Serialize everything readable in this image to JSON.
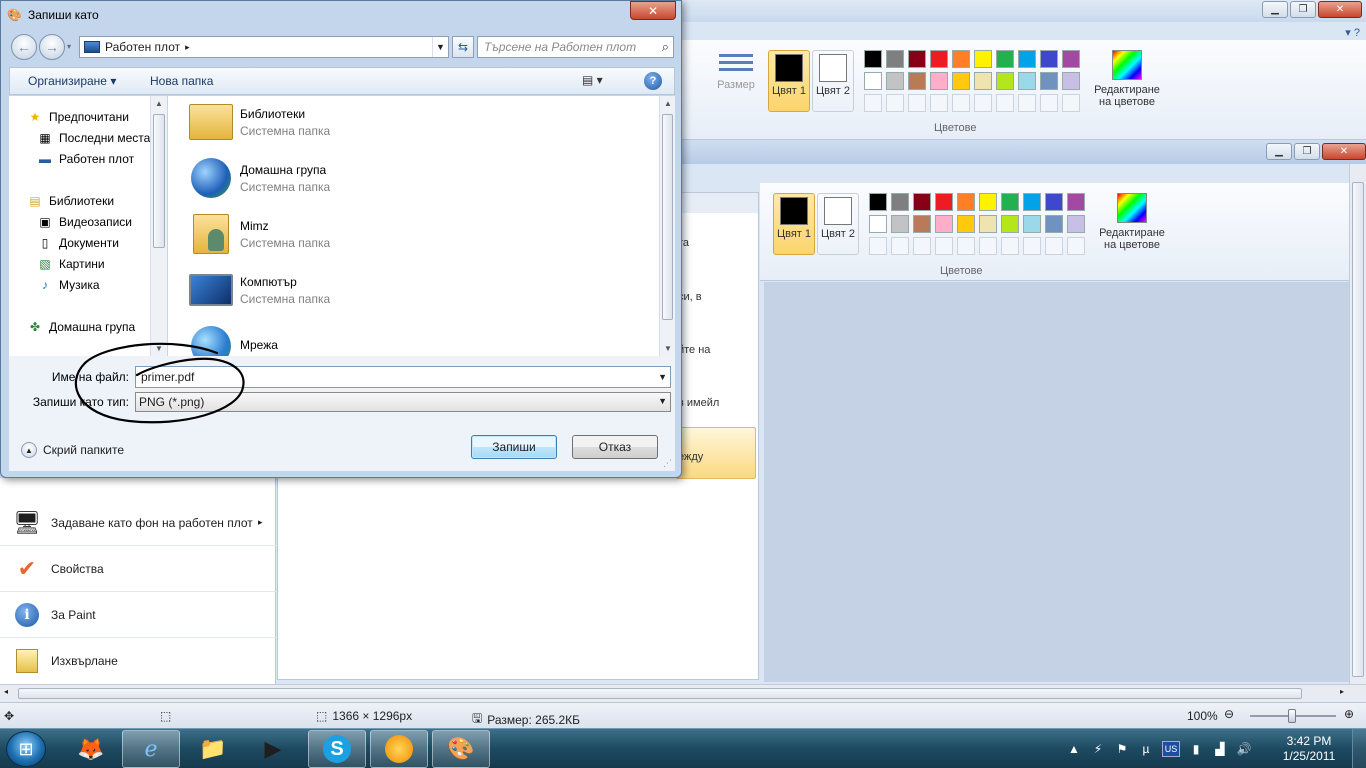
{
  "dialog": {
    "title": "Запиши като",
    "close_label": "✕",
    "address": {
      "location": "Работен плот",
      "separator": "▸"
    },
    "search_placeholder": "Търсене на Работен плот",
    "toolbar": {
      "organize": "Организиране ▾",
      "new_folder": "Нова папка",
      "views": "▤ ▾",
      "help": "?"
    },
    "nav_pane": [
      {
        "label": "Предпочитани",
        "icon": "star-icon"
      },
      {
        "label": "Последни места",
        "icon": "recent-places-icon"
      },
      {
        "label": "Работен плот",
        "icon": "desktop-icon"
      },
      {
        "label": "Библиотеки",
        "icon": "libraries-icon"
      },
      {
        "label": "Видеозаписи",
        "icon": "videos-icon"
      },
      {
        "label": "Документи",
        "icon": "documents-icon"
      },
      {
        "label": "Картини",
        "icon": "pictures-icon"
      },
      {
        "label": "Музика",
        "icon": "music-icon"
      },
      {
        "label": "Домашна група",
        "icon": "homegroup-icon"
      }
    ],
    "files": [
      {
        "name": "Библиотеки",
        "type": "Системна папка",
        "icon": "libraries-folder-icon"
      },
      {
        "name": "Домашна група",
        "type": "Системна папка",
        "icon": "homegroup-icon"
      },
      {
        "name": "Mimz",
        "type": "Системна папка",
        "icon": "user-folder-icon"
      },
      {
        "name": "Компютър",
        "type": "Системна папка",
        "icon": "computer-icon"
      },
      {
        "name": "Мрежа",
        "type": "",
        "icon": "network-icon"
      }
    ],
    "filename_label": "Име на файл:",
    "filename_value": "primer.pdf",
    "filetype_label": "Запиши като тип:",
    "filetype_value": "PNG (*.png)",
    "hide_folders": "Скрий папките",
    "save_button": "Запиши",
    "cancel_button": "Отказ"
  },
  "paint": {
    "size_label": "Размер",
    "color1_label": "Цвят 1",
    "color2_label": "Цвят 2",
    "edit_colors_label": "Редактиране на цветове",
    "colors_group_label": "Цветове",
    "palette_row1": [
      "#000000",
      "#7f7f7f",
      "#880015",
      "#ed1c24",
      "#ff7f27",
      "#fff200",
      "#22b14c",
      "#00a2e8",
      "#3f48cc",
      "#a349a4"
    ],
    "palette_row2": [
      "#ffffff",
      "#c3c3c3",
      "#b97a57",
      "#ffaec9",
      "#ffc90e",
      "#efe4b0",
      "#b5e61d",
      "#99d9ea",
      "#7092be",
      "#c8bfe7"
    ],
    "color1": "#000000",
    "color2": "#ffffff",
    "file_menu": [
      {
        "label": "Задаване като фон на работен плот",
        "icon": "desktop-background-icon",
        "has_submenu": true
      },
      {
        "label": "Свойства",
        "icon": "checkmark-icon",
        "has_submenu": false
      },
      {
        "label": "За Paint",
        "icon": "info-icon",
        "has_submenu": false
      },
      {
        "label": "Изхвърлане",
        "icon": "exit-icon",
        "has_submenu": false
      }
    ],
    "menu_right_fragments": [
      "та",
      "си, в",
      "йте на",
      "в имейл",
      "ежду"
    ],
    "status": {
      "dimensions": "1366 × 1296px",
      "size": "Размер: 265.2КБ",
      "zoom": "100%"
    }
  },
  "taskbar": {
    "apps": [
      {
        "name": "firefox-icon",
        "open": false
      },
      {
        "name": "internet-explorer-icon",
        "open": true
      },
      {
        "name": "windows-explorer-icon",
        "open": false
      },
      {
        "name": "media-player-icon",
        "open": false
      },
      {
        "name": "skype-icon",
        "open": true
      },
      {
        "name": "messenger-icon",
        "open": true
      },
      {
        "name": "paint-icon",
        "open": true
      }
    ],
    "tray_lang": "US",
    "clock_time": "3:42 PM",
    "clock_date": "1/25/2011"
  }
}
